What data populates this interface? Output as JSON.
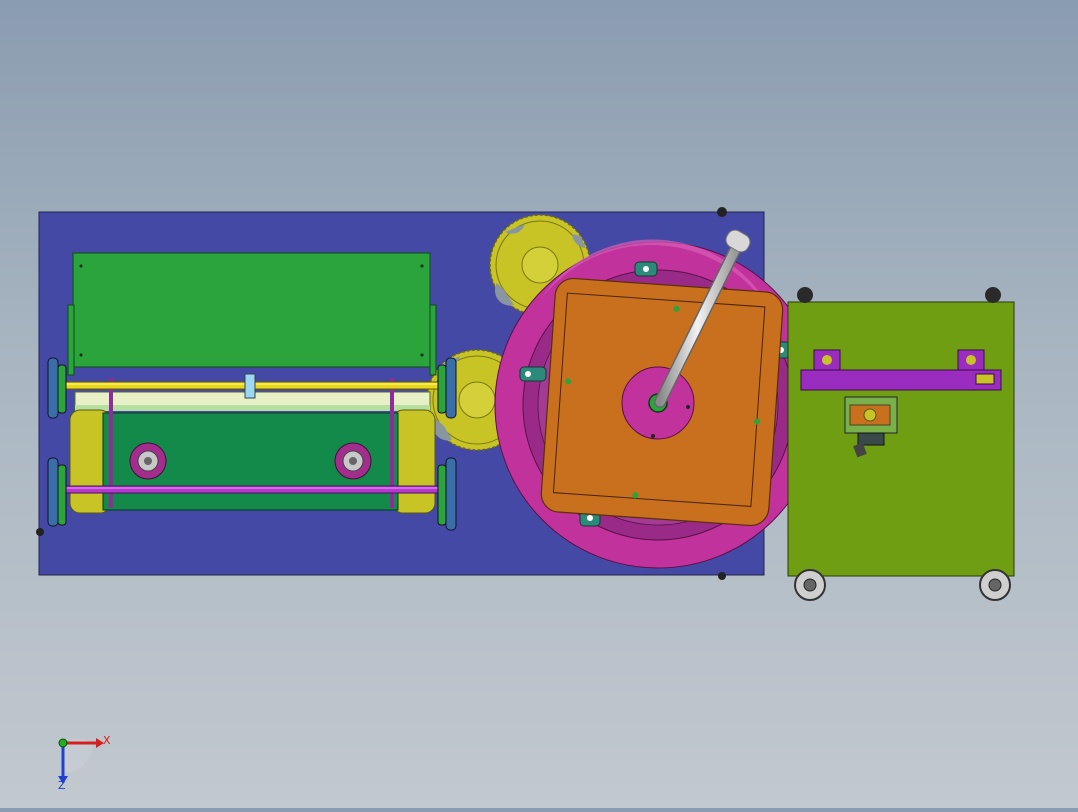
{
  "viewport": {
    "background_top": "#8a9cb0",
    "background_bottom": "#c2c9cf"
  },
  "colors": {
    "base_plate": "#4549a6",
    "green_panel": "#2aa43b",
    "dark_green": "#138a4a",
    "yellow_part": "#c8c426",
    "turntable_ring": "#c2329c",
    "orange_block": "#c8701e",
    "cart_body": "#6f9e12",
    "purple_bracket": "#9a2cbf",
    "axis_x": "#d62020",
    "axis_y": "#20b020",
    "axis_z": "#2040d0"
  },
  "icons": {
    "triad": "xyz-triad-icon",
    "rod": "handle-rod-icon",
    "gear": "gear-icon",
    "wheel": "caster-wheel-icon"
  },
  "triad": {
    "x_label": "X",
    "z_label": "Z"
  }
}
